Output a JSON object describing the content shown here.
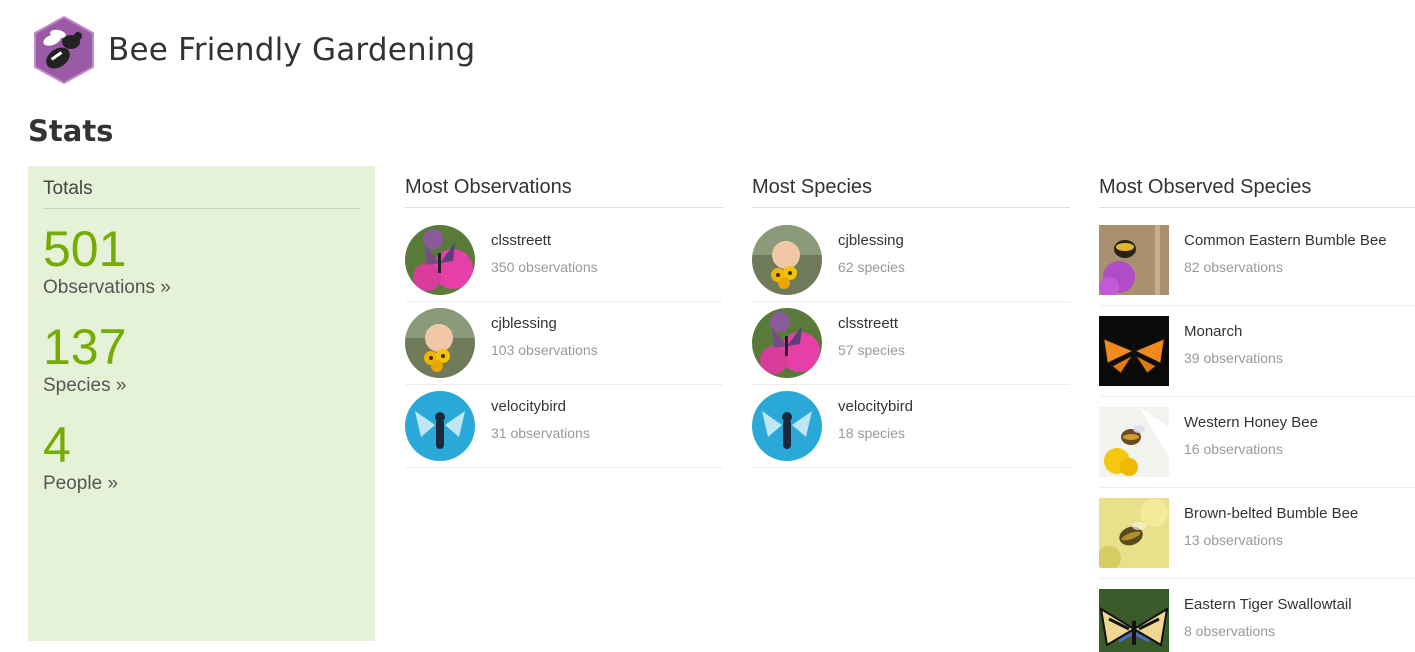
{
  "header": {
    "title": "Bee Friendly Gardening",
    "logo_icon": "bee-hexagon-logo"
  },
  "stats": {
    "heading": "Stats"
  },
  "totals": {
    "title": "Totals",
    "observations": {
      "value": "501",
      "label": "Observations »"
    },
    "species": {
      "value": "137",
      "label": "Species »"
    },
    "people": {
      "value": "4",
      "label": "People »"
    }
  },
  "most_observations": {
    "title": "Most Observations",
    "rows": [
      {
        "name": "clsstreett",
        "count": "350 observations"
      },
      {
        "name": "cjblessing",
        "count": "103 observations"
      },
      {
        "name": "velocitybird",
        "count": "31 observations"
      }
    ]
  },
  "most_species": {
    "title": "Most Species",
    "rows": [
      {
        "name": "cjblessing",
        "count": "62 species"
      },
      {
        "name": "clsstreett",
        "count": "57 species"
      },
      {
        "name": "velocitybird",
        "count": "18 species"
      }
    ]
  },
  "most_observed_species": {
    "title": "Most Observed Species",
    "rows": [
      {
        "name": "Common Eastern Bumble Bee",
        "count": "82 observations"
      },
      {
        "name": "Monarch",
        "count": "39 observations"
      },
      {
        "name": "Western Honey Bee",
        "count": "16 observations"
      },
      {
        "name": "Brown-belted Bumble Bee",
        "count": "13 observations"
      },
      {
        "name": "Eastern Tiger Swallowtail",
        "count": "8 observations"
      }
    ]
  },
  "colors": {
    "accent": "#74ac00",
    "totals_bg": "#e6f2d8",
    "logo": "#9b5aa6"
  }
}
